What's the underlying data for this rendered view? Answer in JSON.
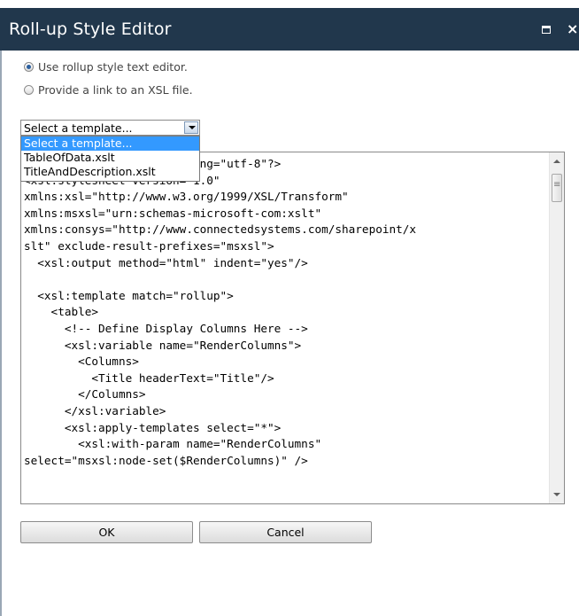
{
  "window": {
    "title": "Roll-up Style Editor",
    "maximize_glyph": "",
    "close_glyph": "×"
  },
  "options": {
    "use_editor_label": "Use rollup style text editor.",
    "use_editor_checked": true,
    "link_xsl_label": "Provide a link to an XSL file.",
    "link_xsl_checked": false
  },
  "template_select": {
    "value": "Select a template...",
    "options": [
      "Select a template...",
      "TableOfData.xslt",
      "TitleAndDescription.xslt"
    ],
    "highlighted": "Select a template..."
  },
  "editor": {
    "lines": [
      "<?xml version=\"1.0\" encoding=\"utf-8\"?>",
      "<xsl:stylesheet version=\"1.0\"",
      "xmlns:xsl=\"http://www.w3.org/1999/XSL/Transform\"",
      "xmlns:msxsl=\"urn:schemas-microsoft-com:xslt\"",
      "xmlns:consys=\"http://www.connectedsystems.com/sharepoint/x",
      "slt\" exclude-result-prefixes=\"msxsl\">",
      "  <xsl:output method=\"html\" indent=\"yes\"/>",
      "",
      "  <xsl:template match=\"rollup\">",
      "    <table>",
      "      <!-- Define Display Columns Here -->",
      "      <xsl:variable name=\"RenderColumns\">",
      "        <Columns>",
      "          <Title headerText=\"Title\"/>",
      "        </Columns>",
      "      </xsl:variable>",
      "      <xsl:apply-templates select=\"*\">",
      "        <xsl:with-param name=\"RenderColumns\"",
      "select=\"msxsl:node-set($RenderColumns)\" />"
    ]
  },
  "buttons": {
    "ok_label": "OK",
    "cancel_label": "Cancel"
  },
  "colors": {
    "titlebar": "#21374c",
    "selection": "#3399ff"
  }
}
